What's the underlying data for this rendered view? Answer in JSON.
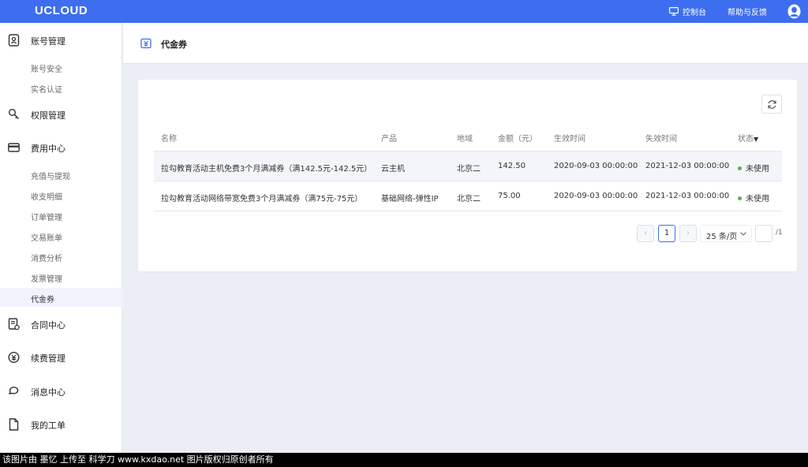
{
  "topbar": {
    "logo": "UCLOUD",
    "console_label": "控制台",
    "help_label": "帮助与反馈"
  },
  "sidebar": {
    "account": {
      "label": "账号管理",
      "children": [
        "账号安全",
        "实名认证"
      ]
    },
    "permission": {
      "label": "权限管理"
    },
    "billing": {
      "label": "费用中心",
      "children": [
        "充值与提现",
        "收支明细",
        "订单管理",
        "交易账单",
        "消费分析",
        "发票管理",
        "代金券"
      ]
    },
    "contract": {
      "label": "合同中心"
    },
    "renewal": {
      "label": "续费管理"
    },
    "messages": {
      "label": "消息中心"
    },
    "tickets": {
      "label": "我的工单"
    },
    "active_item": "代金券"
  },
  "page": {
    "title": "代金券"
  },
  "table": {
    "columns": [
      "名称",
      "产品",
      "地域",
      "金额（元）",
      "生效时间",
      "失效时间",
      "状态"
    ],
    "sort_icon": "▼",
    "rows": [
      {
        "name": "拉勾教育活动主机免费3个月满减券（满142.5元-142.5元）",
        "product": "云主机",
        "region": "北京二",
        "amount": "142.50",
        "start": "2020-09-03 00:00:00",
        "end": "2021-12-03 00:00:00",
        "status": "未使用"
      },
      {
        "name": "拉勾教育活动网络带宽免费3个月满减券（满75元-75元）",
        "product": "基础网络-弹性IP",
        "region": "北京二",
        "amount": "75.00",
        "start": "2020-09-03 00:00:00",
        "end": "2021-12-03 00:00:00",
        "status": "未使用"
      }
    ]
  },
  "pagination": {
    "current_page": "1",
    "page_size_label": "25 条/页",
    "total_label": "/1",
    "prev_glyph": "‹",
    "next_glyph": "›"
  },
  "footer": {
    "text": "该图片由 墨忆 上传至 科学刀 www.kxdao.net 图片版权归原创者所有"
  },
  "colors": {
    "brand": "#3d6ef0",
    "status_unused": "#4bb75c",
    "background": "#eceef5"
  }
}
